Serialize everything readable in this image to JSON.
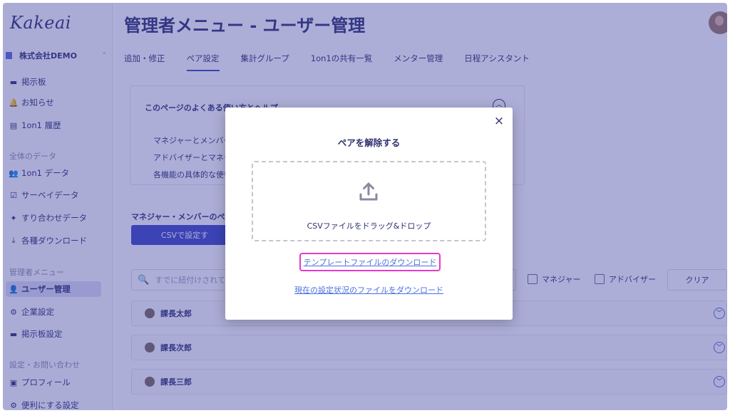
{
  "app": {
    "logo": "Kakeai"
  },
  "sidebar": {
    "company": "株式会社DEMO",
    "items": [
      {
        "label": "掲示板",
        "icon": "▬"
      },
      {
        "label": "お知らせ",
        "icon": "🔔"
      },
      {
        "label": "1on1 履歴",
        "icon": "▤"
      }
    ],
    "section_data": "全体のデータ",
    "data_items": [
      {
        "label": "1on1 データ",
        "icon": "👥"
      },
      {
        "label": "サーベイデータ",
        "icon": "☑"
      },
      {
        "label": "すり合わせデータ",
        "icon": "✦"
      },
      {
        "label": "各種ダウンロード",
        "icon": "⤓"
      }
    ],
    "section_admin": "管理者メニュー",
    "admin_items": [
      {
        "label": "ユーザー管理",
        "icon": "👤"
      },
      {
        "label": "企業設定",
        "icon": "⚙"
      },
      {
        "label": "掲示板設定",
        "icon": "▬"
      }
    ],
    "section_settings": "設定・お問い合わせ",
    "settings_items": [
      {
        "label": "プロフィール",
        "icon": "▣"
      },
      {
        "label": "便利にする設定",
        "icon": "⚙"
      }
    ]
  },
  "header": {
    "title": "管理者メニュー - ユーザー管理"
  },
  "tabs": [
    {
      "label": "追加・修正"
    },
    {
      "label": "ペア設定"
    },
    {
      "label": "集計グループ"
    },
    {
      "label": "1on1の共有一覧"
    },
    {
      "label": "メンター管理"
    },
    {
      "label": "日程アシスタント"
    }
  ],
  "help": {
    "title": "このページのよくある使い方とヘルプ",
    "lines": [
      "マネジャーとメンバー",
      "アドバイザーとマネジ",
      "各機能の具体的な使い"
    ]
  },
  "pair": {
    "heading": "マネジャー・メンバーのペ",
    "csv_button": "CSVで設定す"
  },
  "filter": {
    "search_placeholder": "すでに紐付けされて",
    "manager_label": "マネジャー",
    "advisor_label": "アドバイザー",
    "clear_label": "クリア"
  },
  "managers": [
    {
      "name": "課長太郎"
    },
    {
      "name": "課長次郎"
    },
    {
      "name": "課長三郎"
    }
  ],
  "modal": {
    "title": "ペアを解除する",
    "drop_text": "CSVファイルをドラッグ&ドロップ",
    "template_link": "テンプレートファイルのダウンロード",
    "current_link": "現在の設定状況のファイルをダウンロード",
    "close_icon": "×"
  },
  "colors": {
    "overlay": "#3c3fa0",
    "primary": "#3b47c4",
    "highlight": "#e63acb",
    "link": "#4a6fe0"
  }
}
